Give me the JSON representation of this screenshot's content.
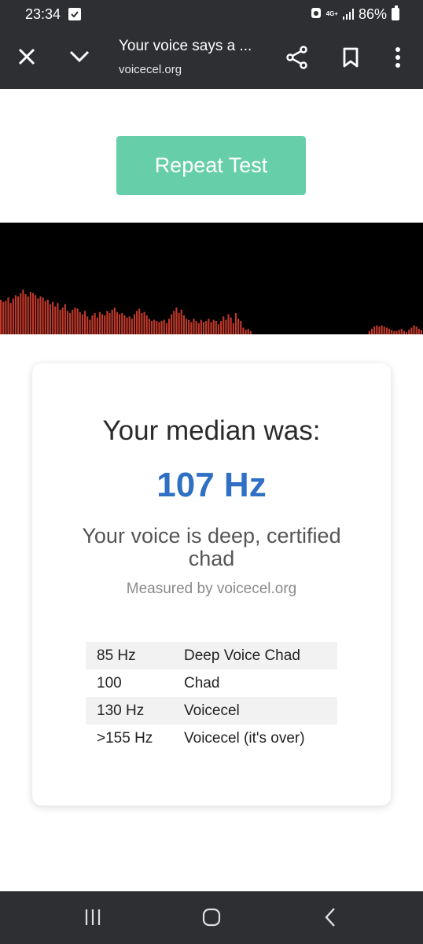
{
  "status": {
    "time": "23:34",
    "network": "4G+",
    "battery": "86%"
  },
  "toolbar": {
    "title": "Your voice says a ...",
    "url": "voicecel.org"
  },
  "page": {
    "repeat_button": "Repeat Test",
    "median_label": "Your median was:",
    "median_value": "107 Hz",
    "verdict": "Your voice is deep, certified chad",
    "measured_by": "Measured by voicecel.org",
    "reference_table": [
      {
        "hz": "85 Hz",
        "label": "Deep Voice Chad"
      },
      {
        "hz": "100",
        "label": "Chad"
      },
      {
        "hz": "130 Hz",
        "label": "Voicecel"
      },
      {
        "hz": ">155 Hz",
        "label": "Voicecel (it's over)"
      }
    ]
  },
  "visualizer": {
    "bar_color": "#c0392b",
    "levels": [
      0.31,
      0.29,
      0.3,
      0.33,
      0.28,
      0.32,
      0.35,
      0.34,
      0.37,
      0.4,
      0.36,
      0.34,
      0.38,
      0.37,
      0.35,
      0.32,
      0.34,
      0.33,
      0.3,
      0.31,
      0.27,
      0.29,
      0.25,
      0.28,
      0.22,
      0.24,
      0.27,
      0.21,
      0.19,
      0.22,
      0.24,
      0.23,
      0.2,
      0.18,
      0.21,
      0.16,
      0.13,
      0.17,
      0.19,
      0.15,
      0.2,
      0.18,
      0.17,
      0.21,
      0.19,
      0.22,
      0.24,
      0.2,
      0.18,
      0.19,
      0.17,
      0.15,
      0.16,
      0.14,
      0.18,
      0.21,
      0.23,
      0.19,
      0.2,
      0.17,
      0.14,
      0.12,
      0.13,
      0.12,
      0.11,
      0.12,
      0.13,
      0.1,
      0.14,
      0.18,
      0.21,
      0.24,
      0.19,
      0.22,
      0.17,
      0.14,
      0.13,
      0.11,
      0.14,
      0.12,
      0.1,
      0.13,
      0.11,
      0.12,
      0.14,
      0.11,
      0.13,
      0.12,
      0.09,
      0.12,
      0.16,
      0.13,
      0.18,
      0.15,
      0.1,
      0.19,
      0.14,
      0.12,
      0.06,
      0.04,
      0.05,
      0.03,
      0,
      0,
      0,
      0,
      0,
      0,
      0,
      0,
      0,
      0,
      0,
      0,
      0,
      0,
      0,
      0,
      0,
      0,
      0,
      0,
      0,
      0,
      0,
      0,
      0,
      0,
      0,
      0,
      0,
      0,
      0,
      0,
      0,
      0,
      0,
      0,
      0,
      0,
      0,
      0,
      0,
      0,
      0,
      0,
      0,
      0,
      0,
      0.03,
      0.05,
      0.07,
      0.08,
      0.07,
      0.08,
      0.07,
      0.06,
      0.05,
      0.04,
      0.03,
      0.03,
      0.04,
      0.05,
      0.03,
      0.02,
      0.04,
      0.06,
      0.08,
      0.07,
      0.05,
      0.04
    ]
  },
  "nav": {
    "recents": "recents-icon",
    "home": "home-icon",
    "back": "back-icon"
  }
}
